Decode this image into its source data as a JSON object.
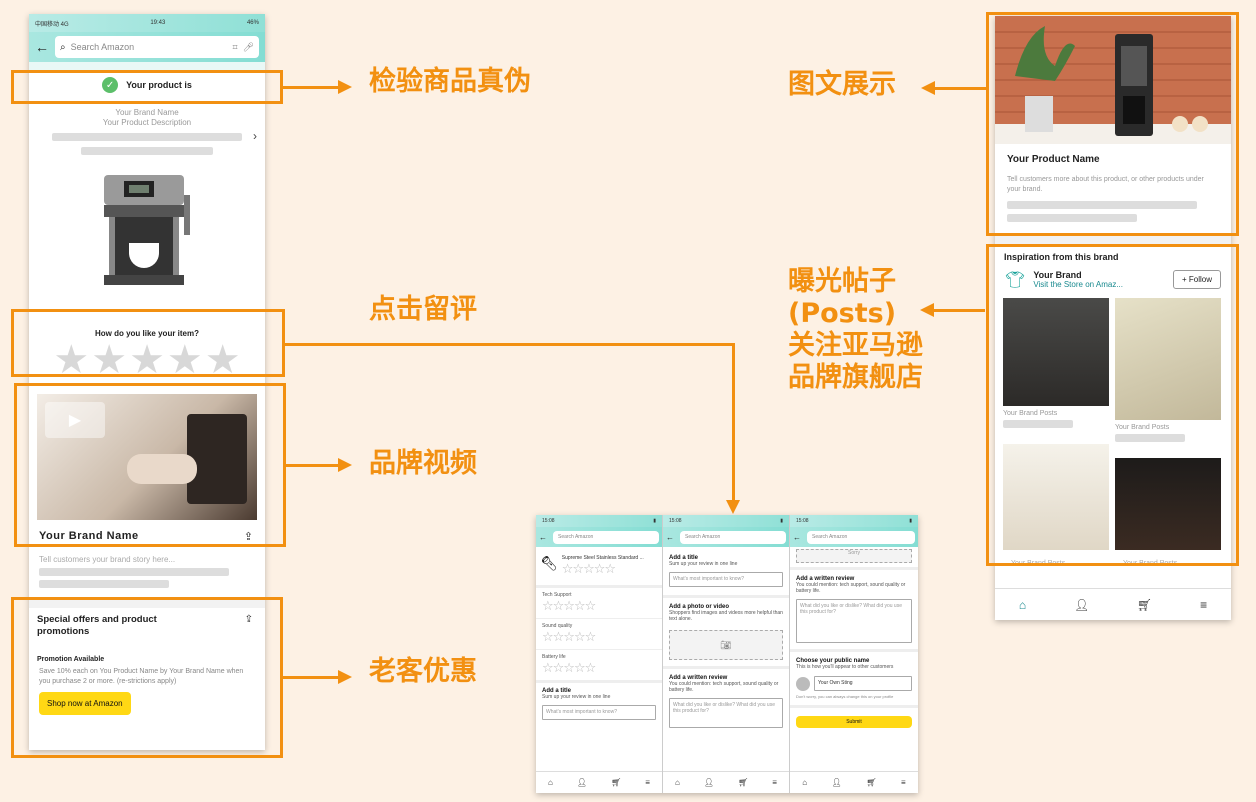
{
  "left_phone": {
    "status": {
      "carrier": "中国移动 4G",
      "time": "19:43",
      "battery": "46%"
    },
    "search_placeholder": "Search Amazon",
    "verify_text": "Your product is",
    "brand_name": "Your Brand Name",
    "product_description": "Your Product Description",
    "rating_question": "How do you like your item?",
    "video_brand_name": "Your Brand Name",
    "brand_story": "Tell customers your brand story here...",
    "offers_title": "Special offers and product promotions",
    "promo_label": "Promotion Available",
    "promo_text": "Save 10% each on You Product Name by Your Brand Name when you purchase 2 or more. (re-strictions apply)",
    "shop_button": "Shop now at Amazon"
  },
  "labels": {
    "verify": "检验商品真伪",
    "review": "点击留评",
    "video": "品牌视频",
    "offers": "老客优惠",
    "image_text": "图文展示",
    "posts_line1": "曝光帖子",
    "posts_line2": "(Posts)",
    "posts_line3": "关注亚马逊",
    "posts_line4": "品牌旗舰店"
  },
  "right_phone": {
    "product_name": "Your Product Name",
    "product_desc": "Tell customers more about this product, or other products under your brand.",
    "inspiration_title": "Inspiration from this brand",
    "brand": "Your Brand",
    "visit_store": "Visit the Store on Amaz...",
    "follow_button": "+ Follow",
    "post_caption": "Your Brand Posts"
  },
  "review_screens": {
    "time": "15:08",
    "search_placeholder": "Search Amazon",
    "product_title": "Supreme Steel Stainless Standard ...",
    "tech_support": "Tech Support",
    "sound_quality": "Sound quality",
    "battery_life": "Battery life",
    "add_title": "Add a title",
    "add_title_sub": "Sum up your review in one line",
    "title_placeholder": "What's most important to know?",
    "add_photo": "Add a photo or video",
    "add_photo_sub": "Shoppers find images and videos more helpful than text alone.",
    "add_review": "Add a written review",
    "add_review_sub": "You could mention: tech support, sound quality or battery life.",
    "review_placeholder": "What did you like or dislike? What did you use this product for?",
    "public_name": "Choose your public name",
    "public_name_sub": "This is how you'll appear to other customers",
    "name_value": "Your Own Sting",
    "name_note": "Don't worry, you can always change this on your profile",
    "submit": "Submit",
    "sorry": "Sorry"
  },
  "colors": {
    "accent": "#f29011",
    "header": "#8fe0d6",
    "yellow": "#ffd814",
    "teal": "#1aa39a"
  }
}
